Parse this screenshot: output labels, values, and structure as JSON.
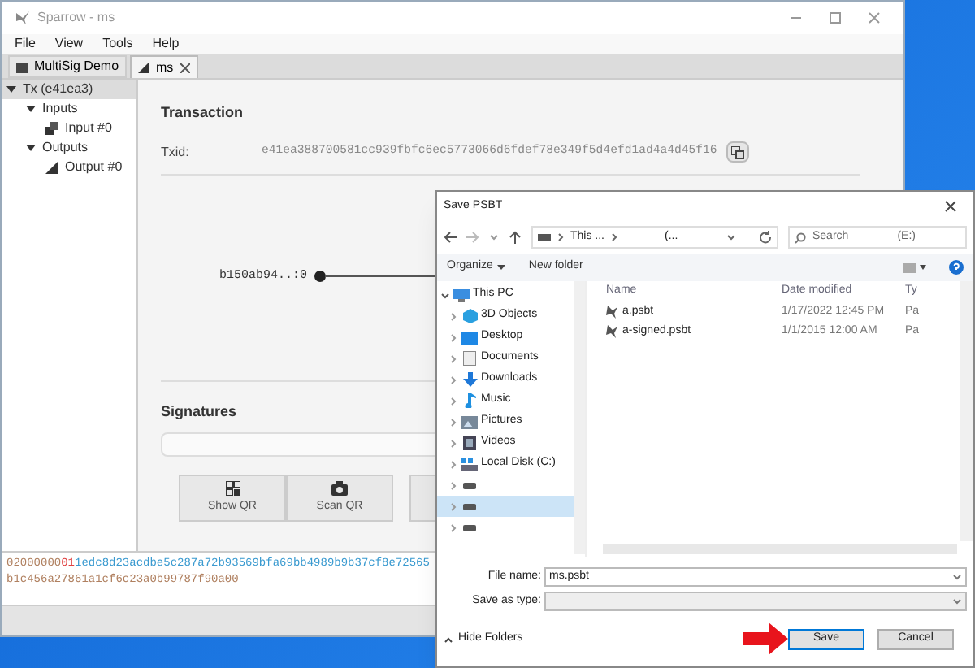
{
  "window": {
    "title": "Sparrow - ms"
  },
  "menu": [
    "File",
    "View",
    "Tools",
    "Help"
  ],
  "tabs": [
    {
      "label": "MultiSig Demo",
      "selected": false,
      "closable": false
    },
    {
      "label": "ms",
      "selected": true,
      "closable": true
    }
  ],
  "tree": [
    {
      "label": "Tx (e41ea3)",
      "selected": true,
      "expanded": true,
      "children": [
        {
          "label": "Inputs",
          "selected": false,
          "expanded": true,
          "children": [
            {
              "label": "Input #0",
              "selected": false,
              "kind": "input"
            }
          ]
        },
        {
          "label": "Outputs",
          "selected": false,
          "expanded": true,
          "children": [
            {
              "label": "Output #0",
              "selected": false,
              "kind": "output"
            }
          ]
        }
      ]
    }
  ],
  "transaction": {
    "heading": "Transaction",
    "txid_label": "Txid:",
    "txid": "e41ea388700581cc939fbfc6ec5773066d6fdef78e349f5d4efd1ad4a4d45f16"
  },
  "diagram": {
    "input_label": "b150ab94..:0"
  },
  "signatures": {
    "heading": "Signatures",
    "buttons": [
      {
        "label": "Show QR",
        "kind": "qr"
      },
      {
        "label": "Scan QR",
        "kind": "camera"
      }
    ]
  },
  "hex": [
    [
      {
        "kind": "version",
        "text": "02000000"
      },
      {
        "kind": "count",
        "text": "01"
      },
      {
        "kind": "txid",
        "text": "1edc8d23acdbe5c287a72b93569bfa69bb4989b9b37cf8e72565"
      }
    ],
    [
      {
        "kind": "version",
        "text": "b1c456a27861a1cf6c23a0b99787f90a00"
      }
    ]
  ],
  "dialog": {
    "title": "Save PSBT",
    "address": [
      "This ...",
      "(..."
    ],
    "search": {
      "placeholder": "Search",
      "drive": "(E:)"
    },
    "toolbar": [
      "Organize",
      "New folder"
    ],
    "nav": [
      {
        "label": "This PC",
        "kind": "pc",
        "expanded": true,
        "selected": false,
        "children": [
          {
            "label": "3D Objects",
            "kind": "objects",
            "selected": false
          },
          {
            "label": "Desktop",
            "kind": "desktop",
            "selected": false
          },
          {
            "label": "Documents",
            "kind": "documents",
            "selected": false
          },
          {
            "label": "Downloads",
            "kind": "downloads",
            "selected": false
          },
          {
            "label": "Music",
            "kind": "music",
            "selected": false
          },
          {
            "label": "Pictures",
            "kind": "pictures",
            "selected": false
          },
          {
            "label": "Videos",
            "kind": "videos",
            "selected": false
          },
          {
            "label": "Local Disk (C:)",
            "kind": "disk",
            "selected": false
          },
          {
            "kind": "drive",
            "selected": false
          },
          {
            "kind": "drive",
            "selected": true
          },
          {
            "kind": "drive",
            "selected": false
          }
        ]
      }
    ],
    "columns": [
      "Name",
      "Date modified",
      "Ty"
    ],
    "files": [
      {
        "name": "a.psbt",
        "date": "1/17/2022 12:45 PM",
        "type": "Pa"
      },
      {
        "name": "a-signed.psbt",
        "date": "1/1/2015 12:00 AM",
        "type": "Pa"
      }
    ],
    "file_name_label": "File name:",
    "file_name": "ms.psbt",
    "save_type_label": "Save as type:",
    "hide_folders": "Hide Folders",
    "buttons": [
      {
        "label": "Save",
        "kind": "primary"
      },
      {
        "label": "Cancel",
        "kind": "secondary"
      }
    ]
  }
}
